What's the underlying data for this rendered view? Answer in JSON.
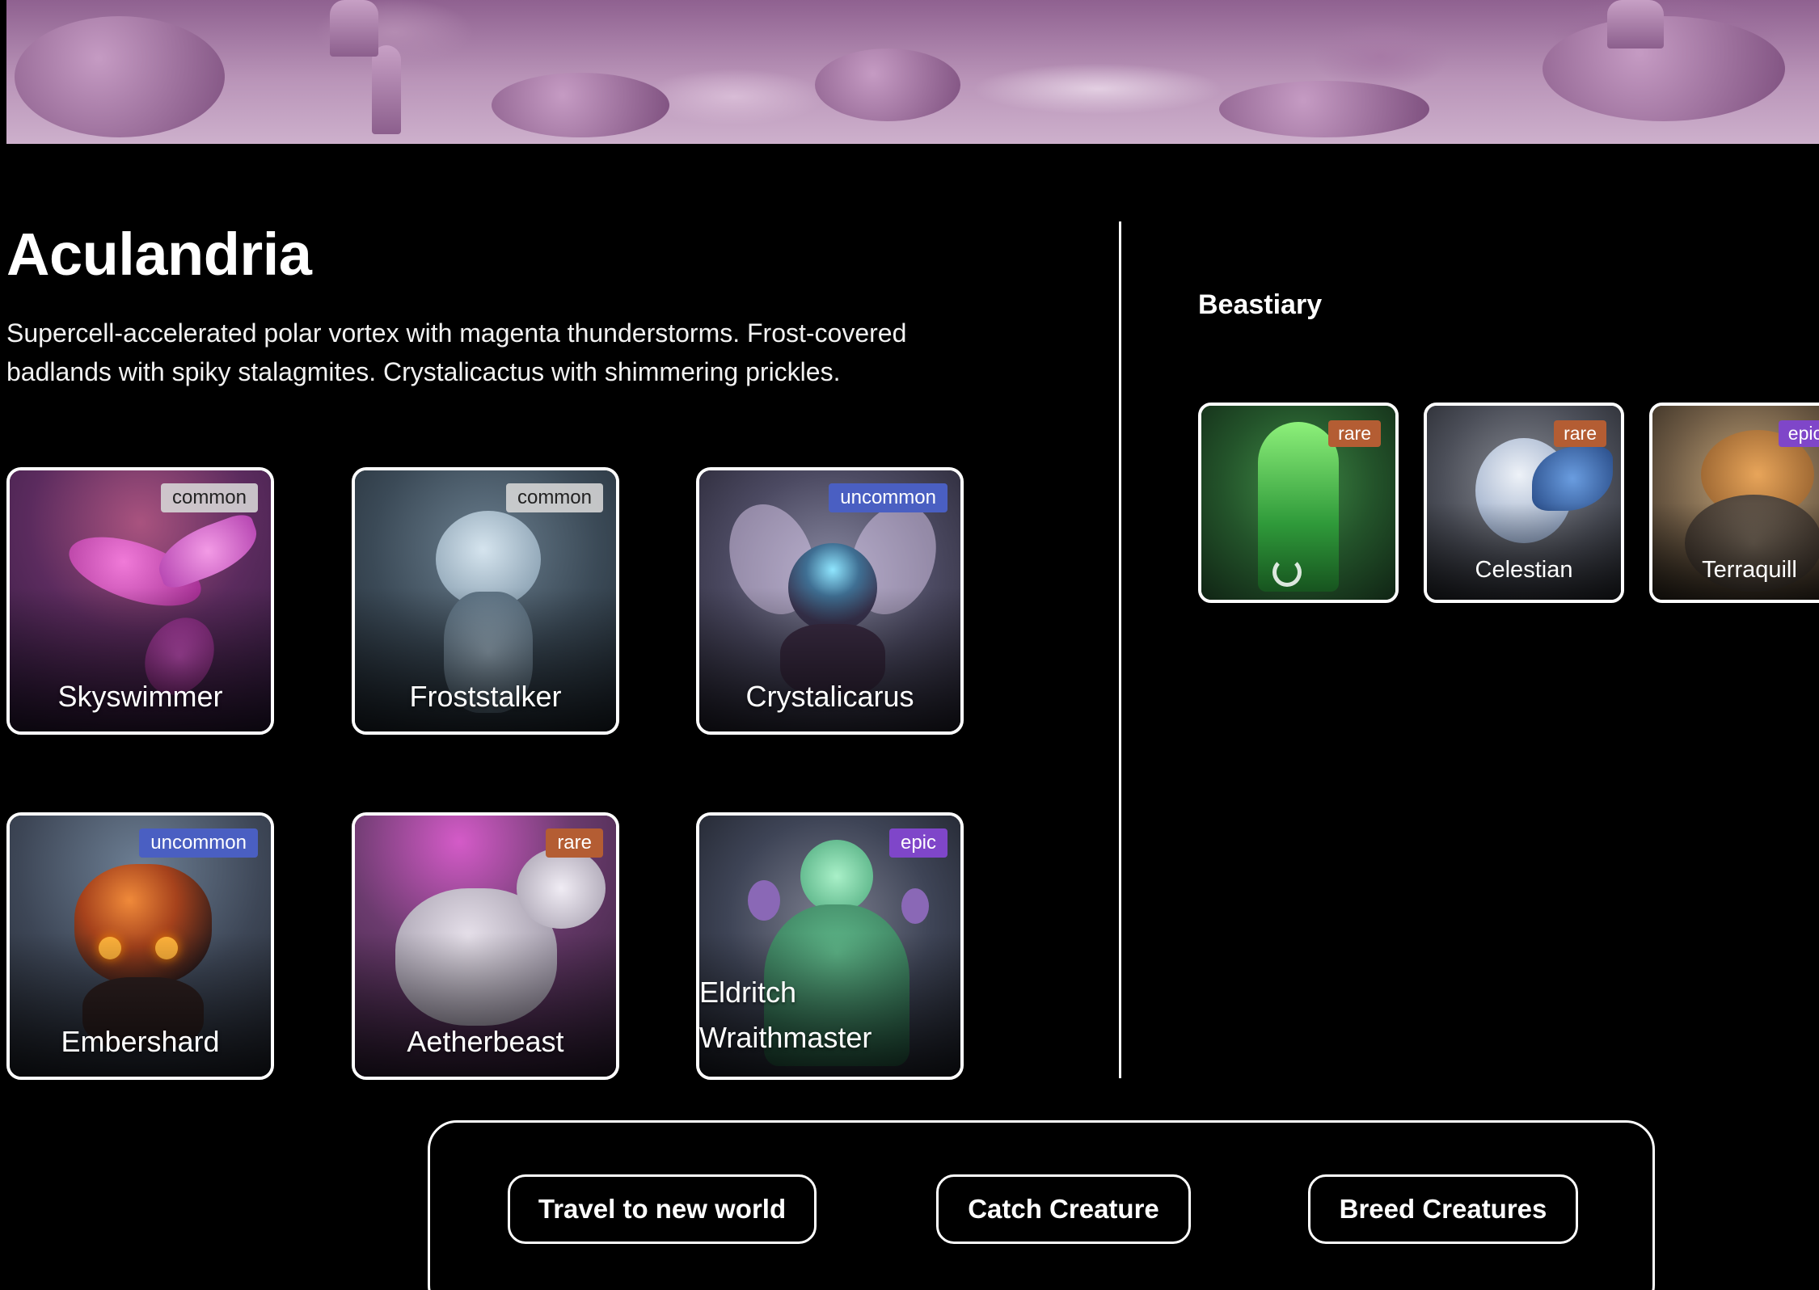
{
  "world": {
    "name": "Aculandria",
    "description": "Supercell-accelerated polar vortex with magenta thunderstorms. Frost-covered badlands with spiky stalagmites. Crystalicactus with shimmering prickles."
  },
  "creatures": [
    {
      "name": "Skyswimmer",
      "rarity": "common"
    },
    {
      "name": "Froststalker",
      "rarity": "common"
    },
    {
      "name": "Crystalicarus",
      "rarity": "uncommon"
    },
    {
      "name": "Embershard",
      "rarity": "uncommon"
    },
    {
      "name": "Aetherbeast",
      "rarity": "rare"
    },
    {
      "name": "Eldritch Wraithmaster",
      "rarity": "epic"
    }
  ],
  "beastiary": {
    "title": "Beastiary",
    "items": [
      {
        "name": "",
        "rarity": "rare",
        "loading": true
      },
      {
        "name": "Celestian",
        "rarity": "rare"
      },
      {
        "name": "Terraquill",
        "rarity": "epic"
      }
    ]
  },
  "actions": {
    "travel": "Travel to new world",
    "catch": "Catch Creature",
    "breed": "Breed Creatures"
  },
  "colors": {
    "common": "#d7d7d7",
    "uncommon": "#4a5fc2",
    "rare": "#b45d33",
    "epic": "#7f46c9"
  },
  "icons": [
    "loading-spinner-icon"
  ]
}
